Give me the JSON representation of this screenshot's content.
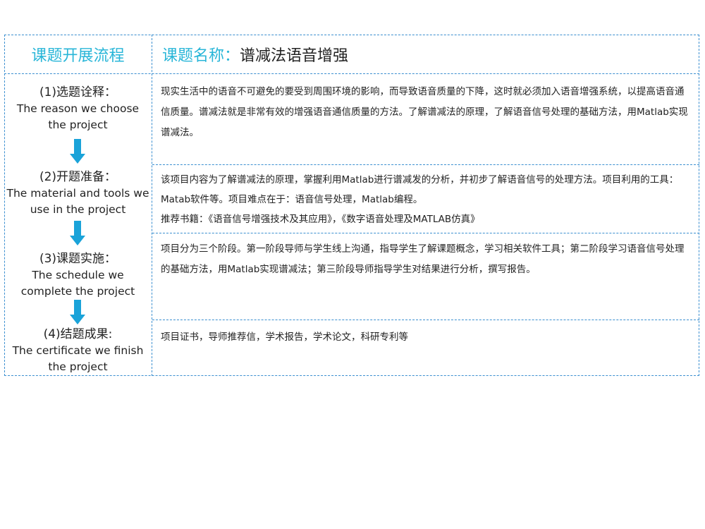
{
  "header": {
    "left_title": "课题开展流程",
    "right_label": "课题名称：",
    "right_title": "谱减法语音增强"
  },
  "steps": [
    {
      "cn": "(1)选题诠释：",
      "en": "The reason we choose the project"
    },
    {
      "cn": "(2)开题准备：",
      "en": "The material and tools we use in the project"
    },
    {
      "cn": "(3)课题实施：",
      "en": "The schedule we complete the project"
    },
    {
      "cn": "(4)结题成果:",
      "en": "The certificate we finish the project"
    }
  ],
  "content": [
    {
      "text": "现实生活中的语音不可避免的要受到周围环境的影响，而导致语音质量的下降，这时就必须加入语音增强系统，以提高语音通信质量。谱减法就是非常有效的增强语音通信质量的方法。了解谱减法的原理，了解语音信号处理的基础方法，用Matlab实现谱减法。"
    },
    {
      "text": "该项目内容为了解谱减法的原理，掌握利用Matlab进行谱减发的分析，并初步了解语音信号的处理方法。项目利用的工具：Matab软件等。项目难点在于：语音信号处理，Matlab编程。",
      "extra": "推荐书籍：《语音信号增强技术及其应用》，《数字语音处理及MATLAB仿真》"
    },
    {
      "text": "项目分为三个阶段。第一阶段导师与学生线上沟通，指导学生了解课题概念，学习相关软件工具；第二阶段学习语音信号处理的基础方法，用Matlab实现谱减法；第三阶段导师指导学生对结果进行分析，撰写报告。"
    },
    {
      "text": "项目证书，导师推荐信，学术报告，学术论文，科研专利等"
    }
  ],
  "colors": {
    "accent": "#29b6d8",
    "border": "#3b8fd0",
    "arrow": "#1aa3d9"
  },
  "icons": {
    "arrow": "down-arrow-icon"
  }
}
